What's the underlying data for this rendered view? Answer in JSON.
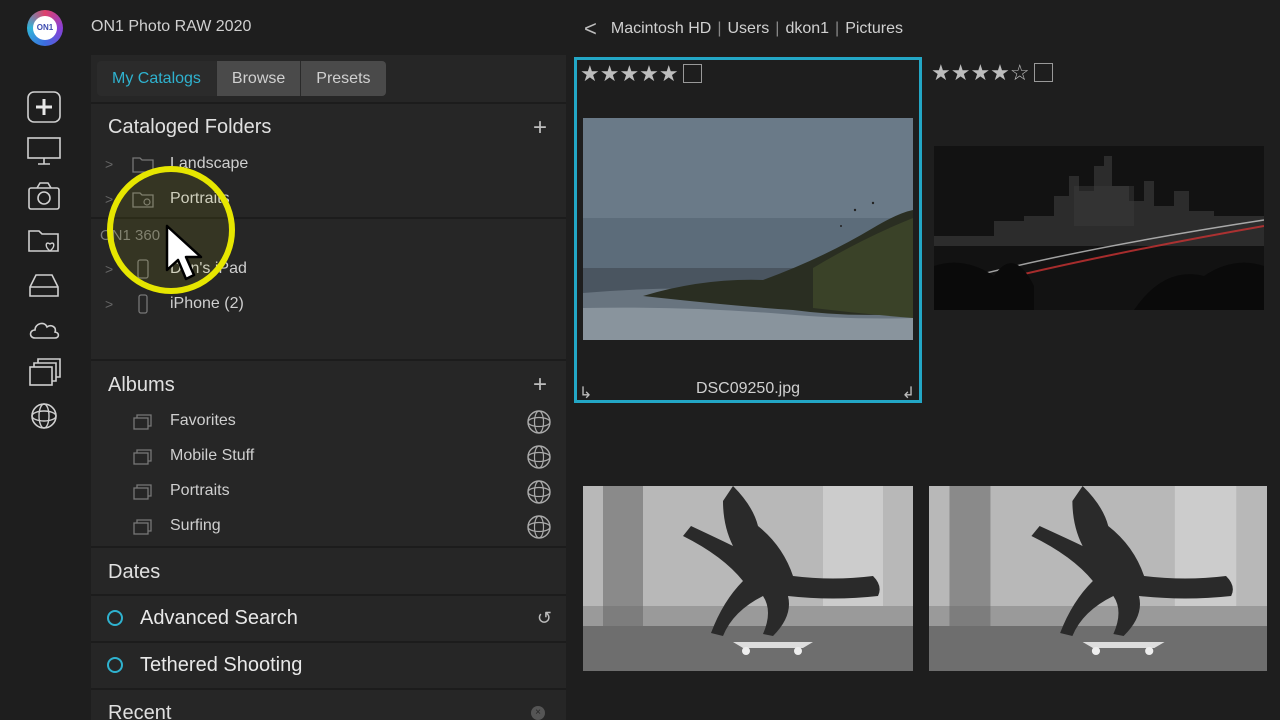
{
  "app": {
    "title": "ON1 Photo RAW 2020",
    "logo_text": "ON1"
  },
  "rail": {
    "items": [
      {
        "icon": "plus-icon",
        "name": "add"
      },
      {
        "icon": "monitor-icon",
        "name": "local-drives"
      },
      {
        "icon": "camera-icon",
        "name": "camera"
      },
      {
        "icon": "folder-heart-icon",
        "name": "favorites"
      },
      {
        "icon": "drive-icon",
        "name": "drive"
      },
      {
        "icon": "cloud-icon",
        "name": "cloud"
      },
      {
        "icon": "stack-icon",
        "name": "albums"
      },
      {
        "icon": "sphere-icon",
        "name": "on1-360"
      }
    ]
  },
  "tabs": [
    "My Catalogs",
    "Browse",
    "Presets"
  ],
  "cataloged_folders": {
    "title": "Cataloged Folders",
    "items": [
      "Landscape",
      "Portraits"
    ]
  },
  "on1_360": {
    "label": "ON1 360",
    "items": [
      "Dan's iPad",
      "iPhone (2)"
    ]
  },
  "albums": {
    "title": "Albums",
    "items": [
      "Favorites",
      "Mobile Stuff",
      "Portraits",
      "Surfing"
    ]
  },
  "dates": {
    "title": "Dates"
  },
  "advanced_search": {
    "label": "Advanced Search"
  },
  "tethered": {
    "label": "Tethered Shooting"
  },
  "recent": {
    "title": "Recent"
  },
  "breadcrumb": [
    "Macintosh HD",
    "Users",
    "dkon1",
    "Pictures"
  ],
  "grid": [
    {
      "file": "DSC09250.jpg",
      "rating": 5,
      "selected": true
    },
    {
      "file": "",
      "rating": 4,
      "selected": false
    },
    {
      "file": "",
      "rating": 0,
      "selected": false
    },
    {
      "file": "",
      "rating": 0,
      "selected": false
    }
  ],
  "stars": {
    "five": "★★★★★",
    "four": "★★★★☆"
  },
  "colors": {
    "accent": "#23a7c6",
    "highlight": "#e6e600"
  }
}
